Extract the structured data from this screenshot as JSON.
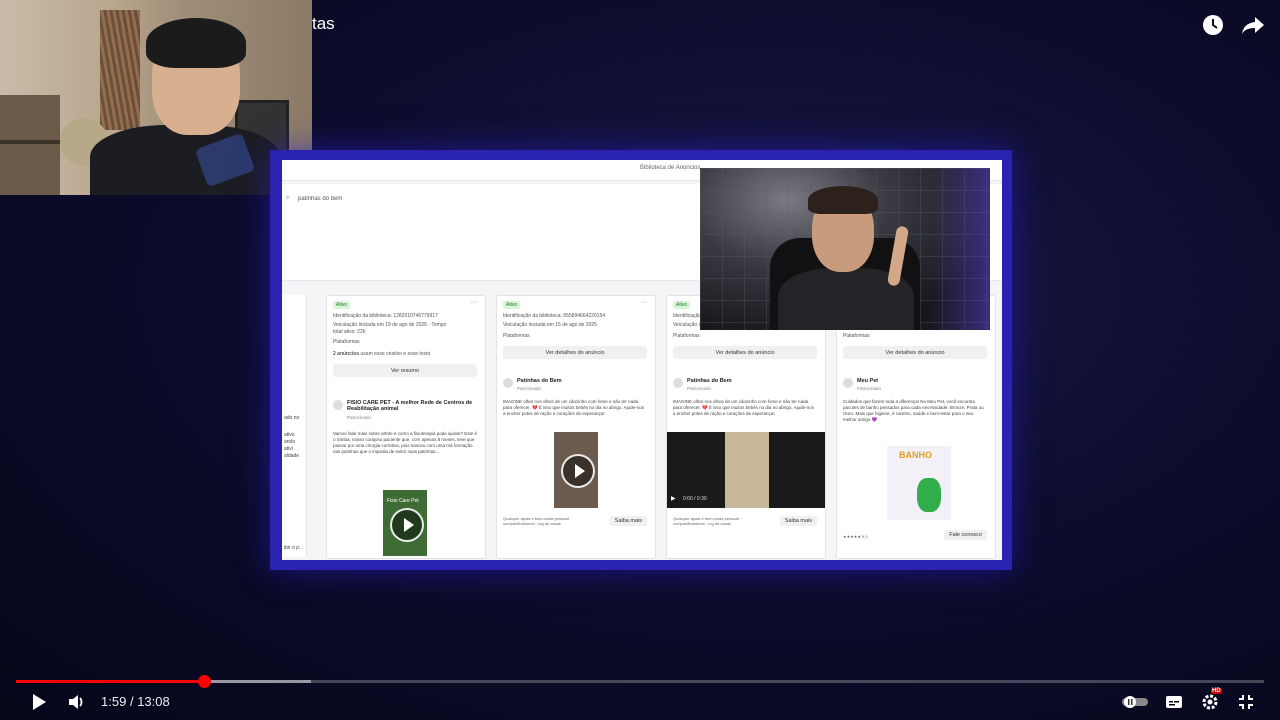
{
  "video": {
    "title": "tas",
    "current_time": "1:59",
    "duration": "13:08",
    "time_separator": "/",
    "progress_played": 0.151,
    "progress_buffered": 0.236,
    "quality_badge": "HD"
  },
  "colors": {
    "progress": "#ff0000",
    "frame": "#2a23b0"
  },
  "icons": {
    "watch_later": "clock-icon",
    "share": "share-icon",
    "play": "play-icon",
    "volume": "volume-icon",
    "autoplay": "autoplay-toggle-icon",
    "captions": "captions-icon",
    "settings": "gear-icon",
    "exit_fullscreen": "exit-fullscreen-icon"
  },
  "screen": {
    "library_link": "Biblioteca de Anúncios",
    "search_value": "patinhas do bem",
    "left_stub_lines": [
      "ado no",
      "ativo",
      "ando",
      "ativi",
      "aldade",
      "ibir o p..."
    ],
    "cards": [
      {
        "status": "Ativo",
        "library_id": "Identificação da biblioteca: 1282010746779917",
        "started": "Veiculação iniciada em 19 de ago de 2025 · Tempo",
        "active_time": "total ativo: 22h",
        "platforms_label": "Plataformas",
        "multi_ads": "2 anúncios",
        "multi_ads_rest": "usam esse criativo e esse texto",
        "button": "Ver resumo",
        "advertiser": "FISIO CARE PET - A melhor Rede de Centros de Reabilitação animal",
        "sponsored": "Patrocinado",
        "body": "Vamos falar mais sobre artrite e como a fisioterapia pode ajudar? Este é o Simba, nosso corajoso paciente que, com apenas 8 meses, teve que passar por uma cirurgia corretiva, pois nasceu com uma má formação nas patinhas que o impedia de exibir suas patinhas...",
        "media_label": "Fisio Care Pet"
      },
      {
        "status": "Ativo",
        "library_id": "Identificação da biblioteca: 655894664220154",
        "started": "Veiculação iniciada em 15 de ago de 2025",
        "platforms_label": "Plataformas",
        "button": "Ver detalhes do anúncio",
        "advertiser": "Patinhas do Bem",
        "sponsored": "Patrocinado",
        "body": "IMAGINE olhar nos olhos de um cãozinho com fome e não ter nada para oferecer. 💔 É isso que muitos bebês no dia no abrigo. Ajude-nos a encher potes de ração e corações de esperança!",
        "footer": "Qualquer ajuda é bem-vinda pessoal! · compartilhamento · log de casas",
        "cta": "Saiba mais"
      },
      {
        "status": "Ativo",
        "library_id": "Identificação da biblioteca",
        "started": "Veiculação iniciada",
        "platforms_label": "Plataformas",
        "button": "Ver detalhes do anúncio",
        "advertiser": "Patinhas do Bem",
        "sponsored": "Patrocinado",
        "body": "IMAGINE olhar nos olhos de um cãozinho com fome e não ter nada para oferecer. 💔 É isso que muitos bebês no dia no abrigo. Ajude-nos a encher potes de ração e corações de esperança!",
        "video_time": "0:00 / 0:30",
        "footer": "Qualquer ajuda é bem-vinda pessoal! · compartilhamento · log de casas",
        "cta": "Saiba mais"
      },
      {
        "platforms_label": "Plataformas",
        "button": "Ver detalhes do anúncio",
        "advertiser": "Meu Pet",
        "sponsored": "Patrocinado",
        "body": "Cuidados que fazem toda a diferença! No Meu Pet, você encontra pacotes de banho pensados para cada necessidade: Bronze, Prata ou Ouro. Mais que higiene, é carinho, saúde e bem-estar para o seu melhor amigo 💜",
        "media_label": "BANHO",
        "footer": "★★★★★ 5,0",
        "cta": "Fale conosco"
      }
    ]
  }
}
